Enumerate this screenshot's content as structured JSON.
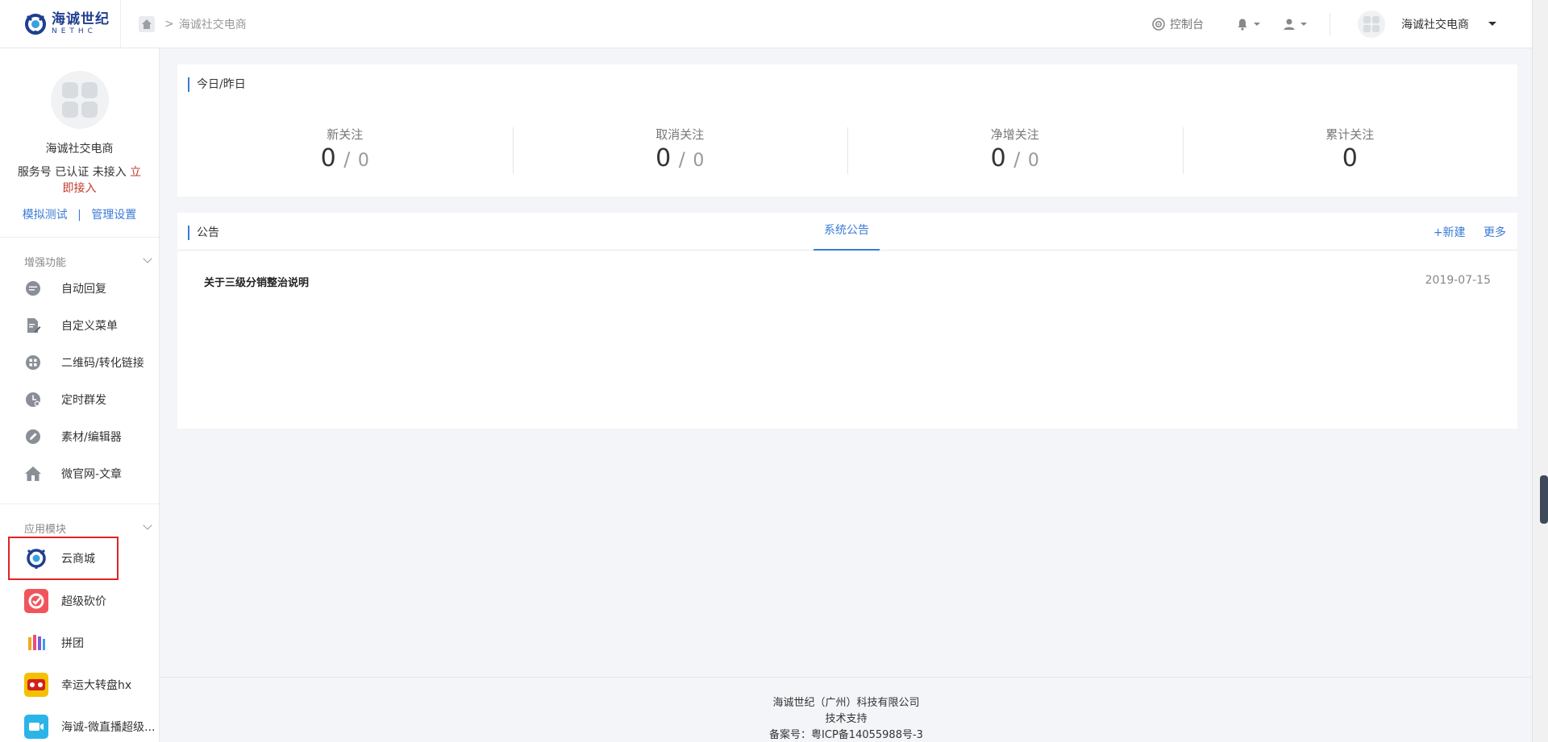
{
  "topbar": {
    "logo_cn": "海诚世纪",
    "logo_en": "NETHC",
    "breadcrumb": "海诚社交电商",
    "console_label": "控制台",
    "account_name": "海诚社交电商"
  },
  "sidebar": {
    "profile_name": "海诚社交电商",
    "status_prefix": "服务号 已认证 未接入",
    "status_link": "立即接入",
    "link_test": "模拟测试",
    "link_sep": "|",
    "link_manage": "管理设置",
    "section1_title": "增强功能",
    "menu": [
      {
        "label": "自动回复",
        "icon": "chat-icon"
      },
      {
        "label": "自定义菜单",
        "icon": "edit-doc-icon"
      },
      {
        "label": "二维码/转化链接",
        "icon": "qrcode-icon"
      },
      {
        "label": "定时群发",
        "icon": "clock-icon"
      },
      {
        "label": "素材/编辑器",
        "icon": "pencil-icon"
      },
      {
        "label": "微官网-文章",
        "icon": "home-icon"
      }
    ],
    "section2_title": "应用模块",
    "apps": [
      {
        "label": "云商城",
        "icon": "cloud-mall-icon"
      },
      {
        "label": "超级砍价",
        "icon": "bargain-icon"
      },
      {
        "label": "拼团",
        "icon": "group-buy-icon"
      },
      {
        "label": "幸运大转盘hx",
        "icon": "lucky-wheel-icon"
      },
      {
        "label": "海诚-微直播超级...",
        "icon": "live-icon"
      }
    ]
  },
  "stats_card": {
    "title": "今日/昨日",
    "items": [
      {
        "label": "新关注",
        "today": "0",
        "sep": "/",
        "yesterday": "0"
      },
      {
        "label": "取消关注",
        "today": "0",
        "sep": "/",
        "yesterday": "0"
      },
      {
        "label": "净增关注",
        "today": "0",
        "sep": "/",
        "yesterday": "0"
      },
      {
        "label": "累计关注",
        "today": "0"
      }
    ]
  },
  "notice_card": {
    "title": "公告",
    "tab": "系统公告",
    "new_label": "+新建",
    "more_label": "更多",
    "items": [
      {
        "title": "关于三级分销整治说明",
        "date": "2019-07-15"
      }
    ]
  },
  "footer": {
    "company": "海诚世纪（广州）科技有限公司",
    "support": "技术支持",
    "icp": "备案号：粤ICP备14055988号-3"
  },
  "colors": {
    "accent": "#3a7bd5",
    "highlight_box": "#e02424",
    "warning_link": "#c0392b"
  }
}
